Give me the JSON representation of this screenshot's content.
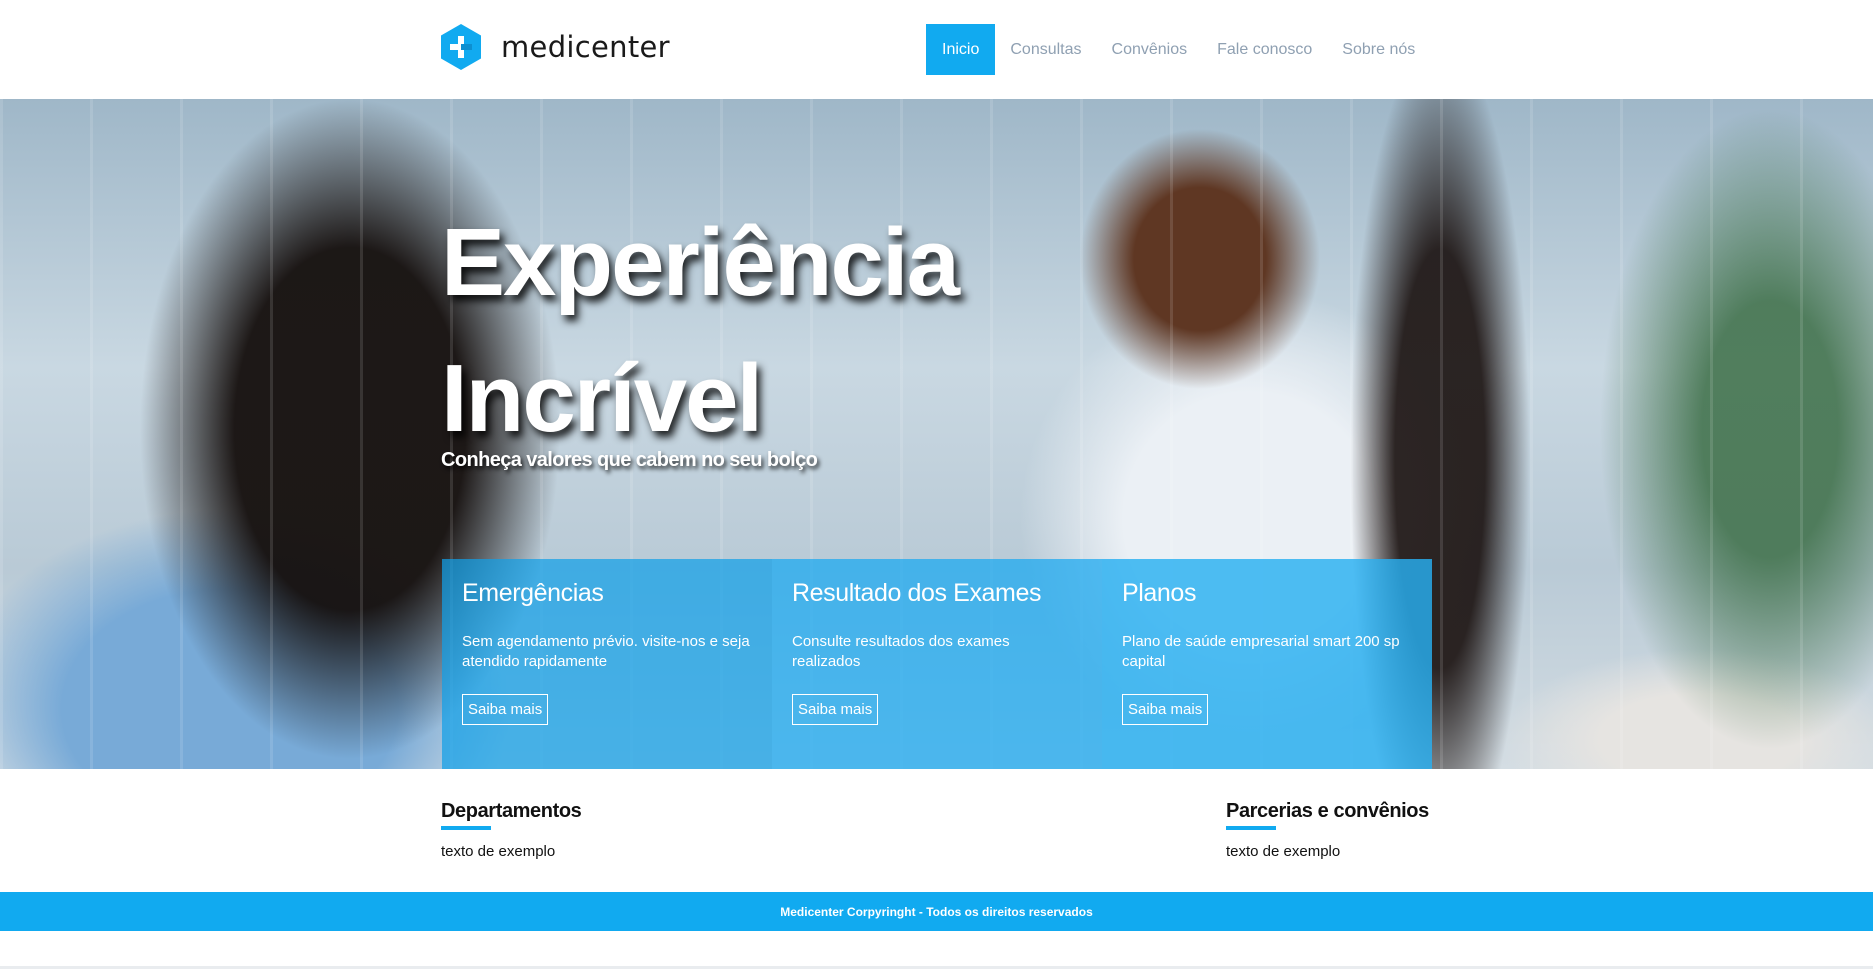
{
  "brand": {
    "name": "medicenter",
    "accent": "#11aaf0",
    "logo_icon": "hexagon-plus-icon"
  },
  "nav": {
    "items": [
      {
        "label": "Inicio",
        "active": true
      },
      {
        "label": "Consultas",
        "active": false
      },
      {
        "label": "Convênios",
        "active": false
      },
      {
        "label": "Fale conosco",
        "active": false
      },
      {
        "label": "Sobre nós",
        "active": false
      }
    ]
  },
  "hero": {
    "title_line1": "Experiência",
    "title_line2": "Incrível",
    "subtitle": "Conheça valores que cabem no seu bolço"
  },
  "cards": [
    {
      "title": "Emergências",
      "text": "Sem agendamento prévio. visite-nos e seja atendido rapidamente",
      "button": "Saiba mais"
    },
    {
      "title": "Resultado dos Exames",
      "text": "Consulte resultados dos exames realizados",
      "button": "Saiba mais"
    },
    {
      "title": "Planos",
      "text": "Plano de saúde empresarial smart 200 sp capital",
      "button": "Saiba mais"
    }
  ],
  "sections": {
    "departments": {
      "title": "Departamentos",
      "text": "texto de exemplo"
    },
    "partners": {
      "title": "Parcerias e convênios",
      "text": "texto de exemplo"
    }
  },
  "footer": {
    "text": "Medicenter Corpyringht - Todos os direitos reservados"
  }
}
